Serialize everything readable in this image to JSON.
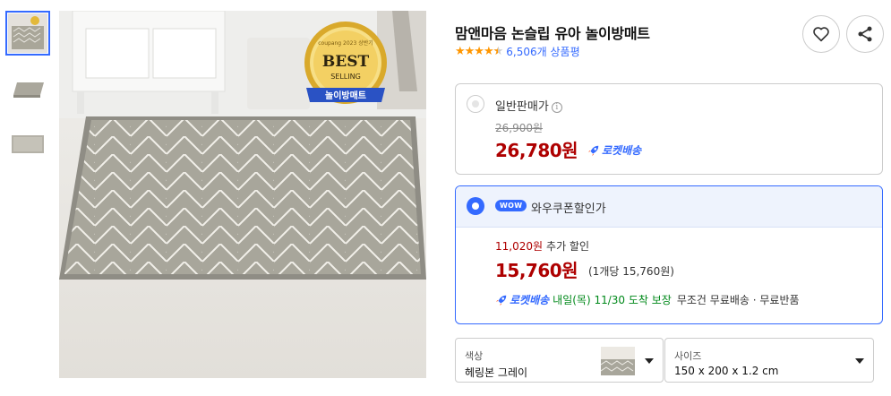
{
  "product": {
    "title": "맘앤마음 논슬립 유아 놀이방매트",
    "rating_value": 4.5,
    "review_count": "6,506개 상품평"
  },
  "thumbnails": [
    {
      "name": "thumbnail-1",
      "active": true
    },
    {
      "name": "thumbnail-2",
      "active": false
    },
    {
      "name": "thumbnail-3",
      "active": false
    }
  ],
  "badge": {
    "brand": "coupang 2023 상반기",
    "line1": "BEST",
    "line2": "SELLING",
    "ribbon": "놀이방매트"
  },
  "regular": {
    "label": "일반판매가",
    "original_price": "26,900원",
    "price": "26,780원",
    "rocket_label": "로켓배송"
  },
  "wow": {
    "badge": "WOW",
    "label": "와우쿠폰할인가",
    "discount_amount": "11,020원",
    "discount_text": "추가 할인",
    "price": "15,760원",
    "unit_price": "(1개당 15,760원)",
    "rocket_label": "로켓배송",
    "arrival": "내일(목) 11/30 도착 보장",
    "shipping": "무조건 무료배송 · 무료반품"
  },
  "options": {
    "color_label": "색상",
    "color_value": "헤링본 그레이",
    "size_label": "사이즈",
    "size_value": "150 x 200 x 1.2 cm"
  },
  "colors": {
    "accent": "#346aff",
    "price_red": "#ae0000",
    "star": "#ff9600",
    "delivery_green": "#00891a"
  },
  "icons": [
    "heart-icon",
    "share-icon",
    "info-icon",
    "rocket-icon",
    "caret-down-icon"
  ]
}
